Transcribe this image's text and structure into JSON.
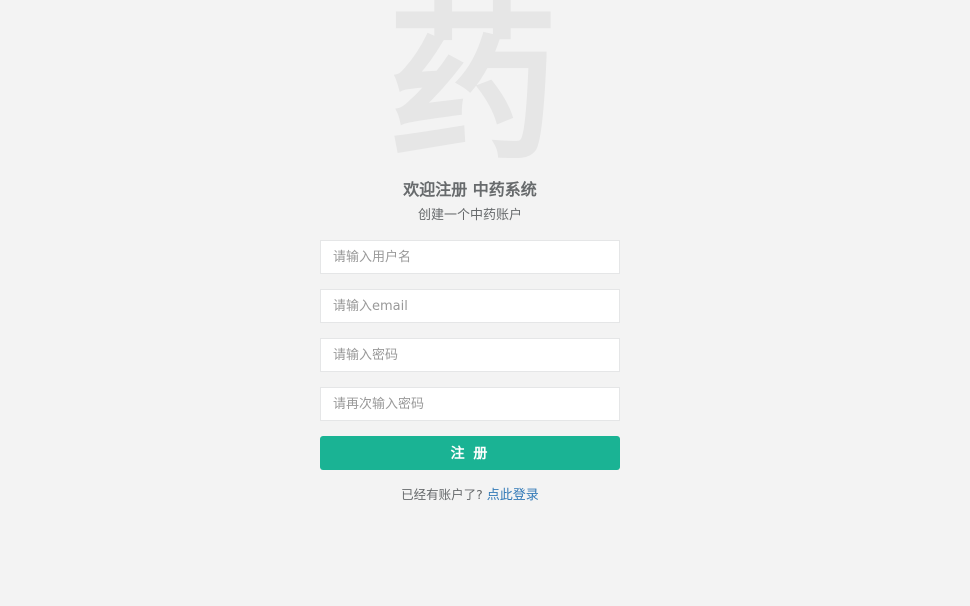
{
  "logo": {
    "text": "药"
  },
  "header": {
    "title": "欢迎注册 中药系统",
    "subtitle": "创建一个中药账户"
  },
  "form": {
    "username": {
      "value": "",
      "placeholder": "请输入用户名"
    },
    "email": {
      "value": "",
      "placeholder": "请输入email"
    },
    "password": {
      "value": "",
      "placeholder": "请输入密码"
    },
    "confirm_password": {
      "value": "",
      "placeholder": "请再次输入密码"
    },
    "submit_label": "注 册"
  },
  "footer": {
    "prompt": "已经有账户了?",
    "login_link": "点此登录"
  },
  "colors": {
    "background": "#f3f3f3",
    "primary": "#1ab394",
    "link": "#337ab7",
    "logo": "#e6e6e6",
    "text": "#676a6c"
  }
}
